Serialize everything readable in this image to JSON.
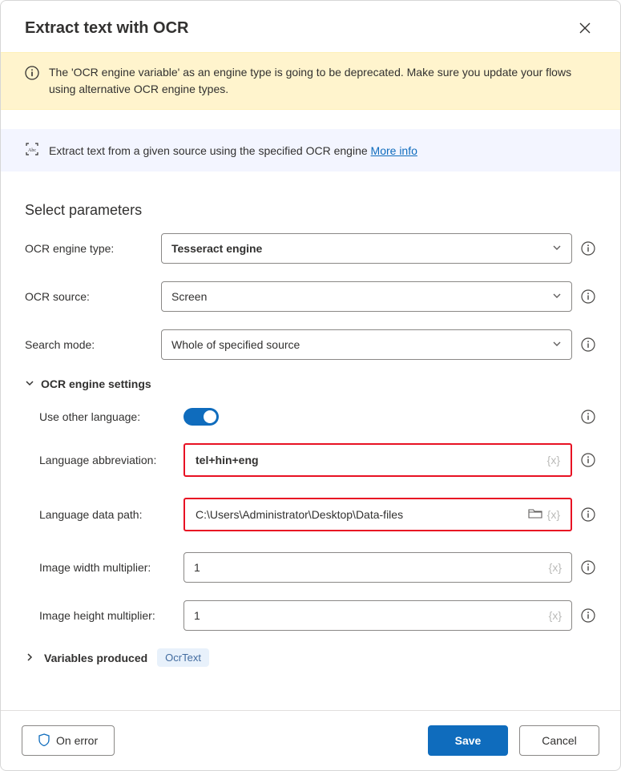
{
  "dialog": {
    "title": "Extract text with OCR"
  },
  "warning": {
    "text": "The 'OCR engine variable' as an engine type is going to be deprecated.  Make sure you update your flows using alternative OCR engine types."
  },
  "description": {
    "text": "Extract text from a given source using the specified OCR engine ",
    "link": "More info"
  },
  "sections": {
    "params_title": "Select parameters",
    "engine_settings": "OCR engine settings",
    "vars_produced": "Variables produced"
  },
  "fields": {
    "engine_type": {
      "label": "OCR engine type:",
      "value": "Tesseract engine"
    },
    "ocr_source": {
      "label": "OCR source:",
      "value": "Screen"
    },
    "search_mode": {
      "label": "Search mode:",
      "value": "Whole of specified source"
    },
    "use_other_lang": {
      "label": "Use other language:",
      "on": true
    },
    "lang_abbrev": {
      "label": "Language abbreviation:",
      "value": "tel+hin+eng"
    },
    "lang_path": {
      "label": "Language data path:",
      "value": "C:\\Users\\Administrator\\Desktop\\Data-files"
    },
    "img_w_mult": {
      "label": "Image width multiplier:",
      "value": "1"
    },
    "img_h_mult": {
      "label": "Image height multiplier:",
      "value": "1"
    }
  },
  "variables": {
    "chip": "OcrText"
  },
  "footer": {
    "on_error": "On error",
    "save": "Save",
    "cancel": "Cancel"
  }
}
